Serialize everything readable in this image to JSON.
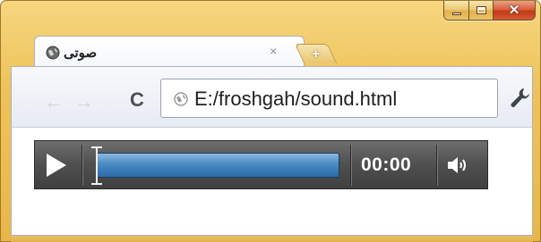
{
  "window": {
    "caption_buttons": {
      "minimize_icon": "minimize-icon",
      "maximize_icon": "maximize-icon",
      "close_glyph": "✕"
    }
  },
  "tab": {
    "title": "صوتی",
    "close_glyph": "×",
    "new_tab_glyph": "+",
    "favicon": "globe-icon"
  },
  "toolbar": {
    "back_glyph": "←",
    "forward_glyph": "→",
    "reload_glyph": "C",
    "url": "E:/froshgah/sound.html",
    "menu_icon": "wrench-icon"
  },
  "player": {
    "time": "00:00",
    "progress": 0,
    "play_icon": "play-icon",
    "volume_icon": "volume-icon"
  },
  "colors": {
    "frame": "#efc35a",
    "close_button": "#c23a18",
    "player_bg": "#4f4f4f",
    "progress": "#2a6aa8"
  }
}
